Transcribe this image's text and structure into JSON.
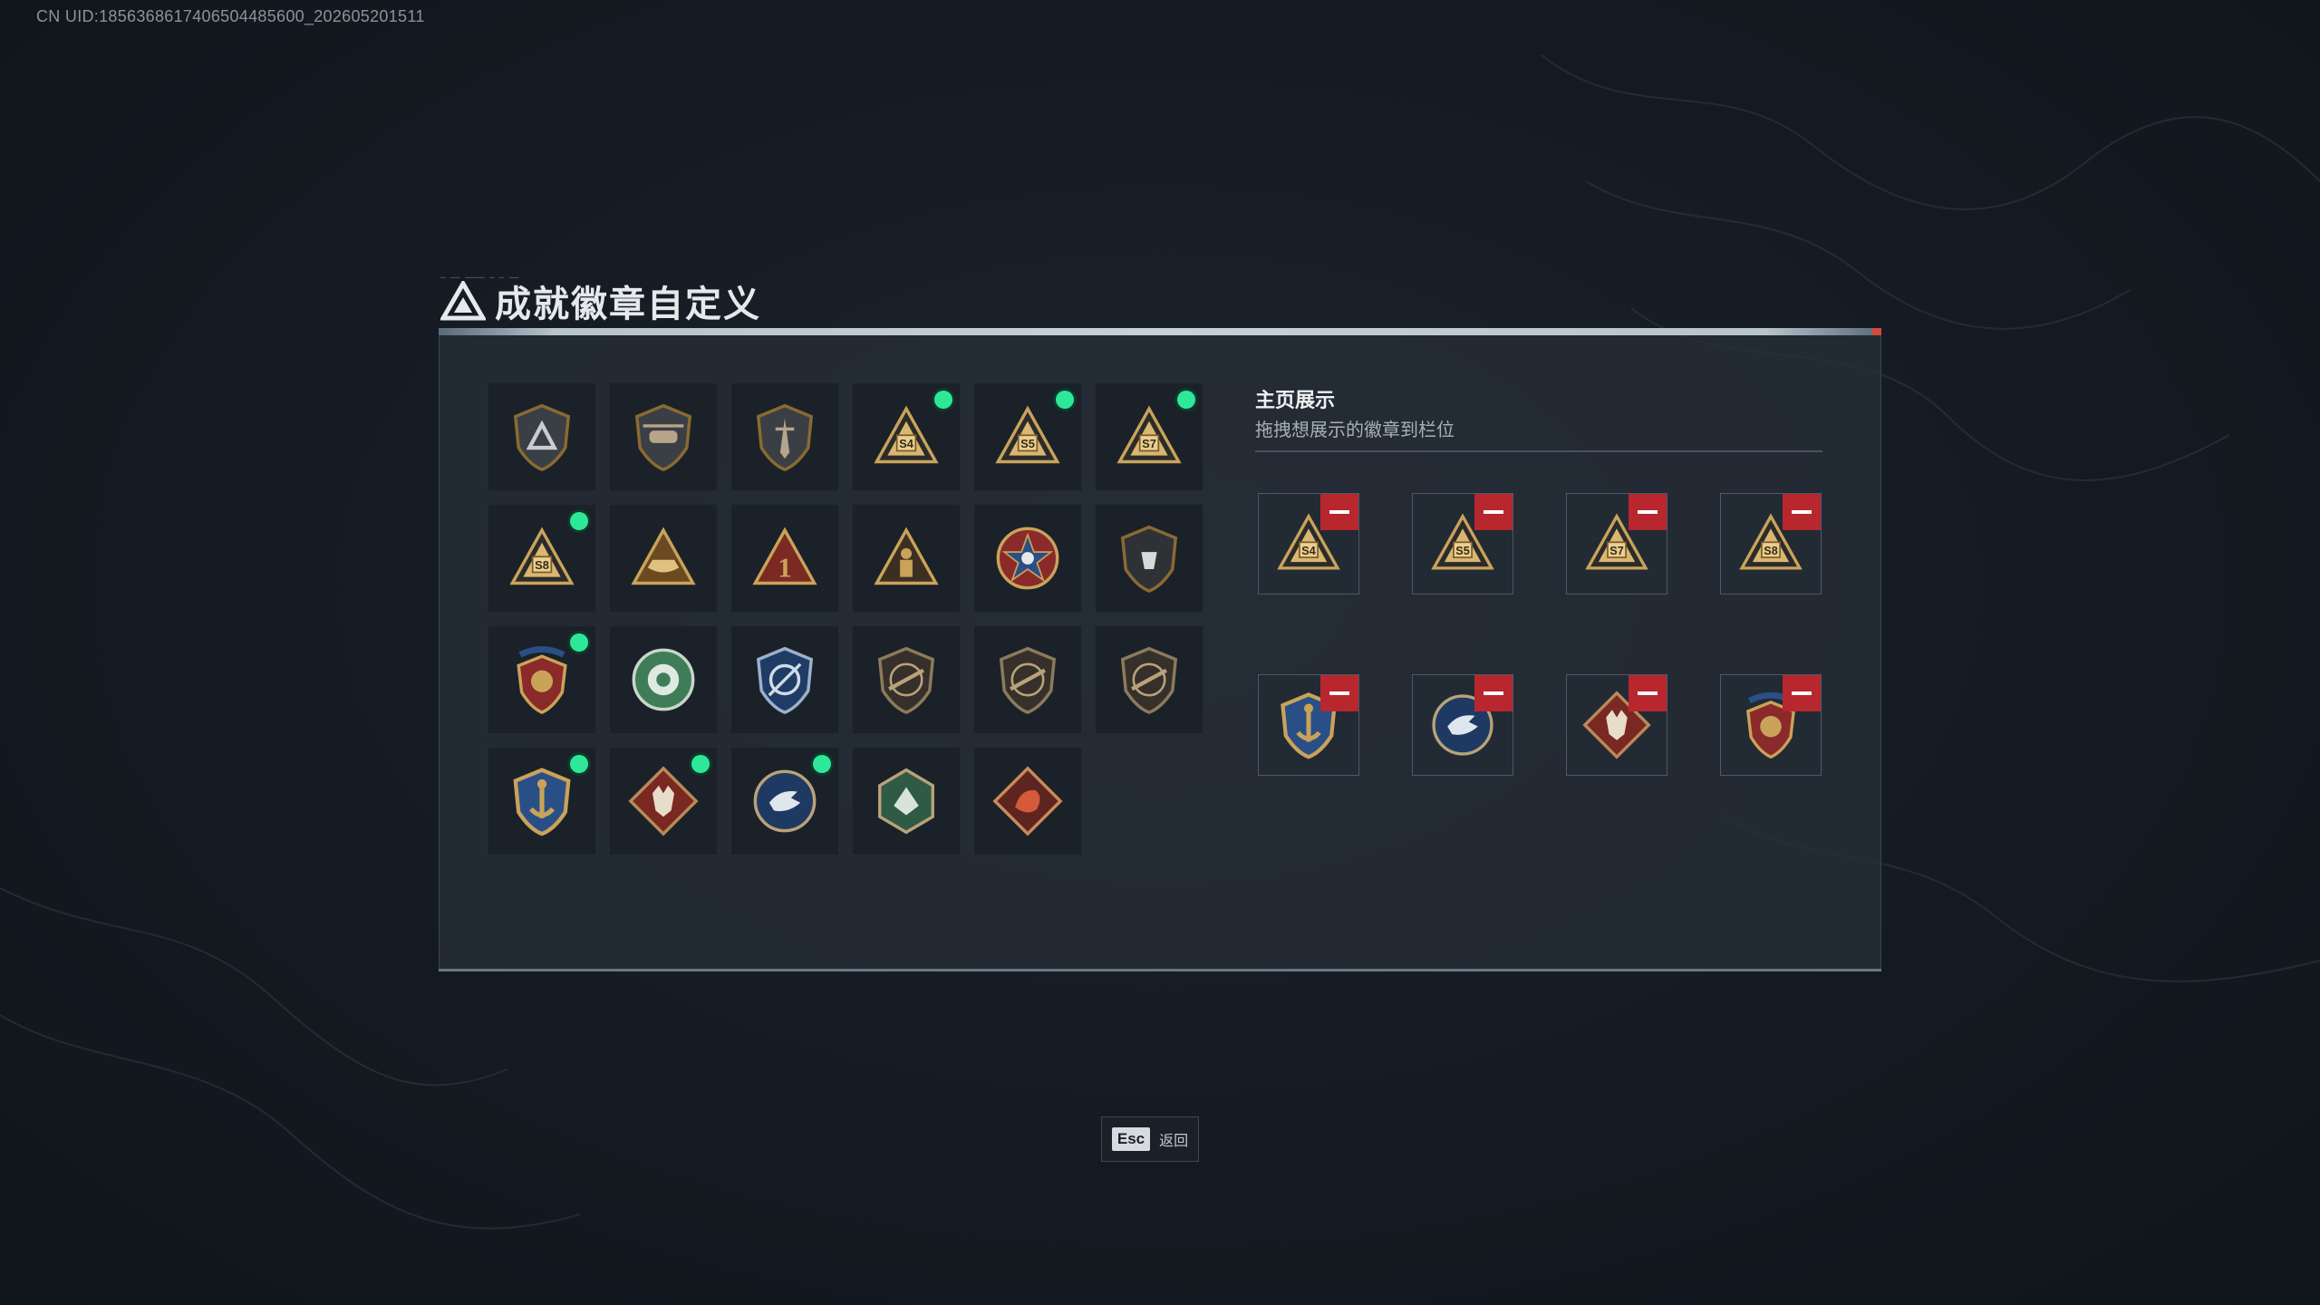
{
  "watermark": {
    "uid": "CN UID:1856368617406504485600_202605201511"
  },
  "header": {
    "title": "成就徽章自定义",
    "deco": "─ ── ──── ─ ─ ──"
  },
  "colors": {
    "accent_green": "#2ee89a",
    "remove_red": "#b8262e",
    "gold": "#c9a35a",
    "panel": "#262e37"
  },
  "badge_grid": {
    "items": [
      {
        "icon": "triangle-shield-badge-icon",
        "new": false
      },
      {
        "icon": "helicopter-shield-badge-icon",
        "new": false
      },
      {
        "icon": "dagger-shield-badge-icon",
        "new": false
      },
      {
        "icon": "season-s4-badge-icon",
        "new": true,
        "label": "S4"
      },
      {
        "icon": "season-s5-badge-icon",
        "new": true,
        "label": "S5"
      },
      {
        "icon": "season-s7-badge-icon",
        "new": true,
        "label": "S7"
      },
      {
        "icon": "season-s8-badge-icon",
        "new": true,
        "label": "S8"
      },
      {
        "icon": "boat-triangle-badge-icon",
        "new": false
      },
      {
        "icon": "rank-one-triangle-badge-icon",
        "new": false,
        "label": "1"
      },
      {
        "icon": "soldier-triangle-badge-icon",
        "new": false
      },
      {
        "icon": "skull-star-badge-icon",
        "new": false
      },
      {
        "icon": "hand-shield-badge-icon",
        "new": false
      },
      {
        "icon": "starred-crest-badge-icon",
        "new": true
      },
      {
        "icon": "green-emblem-badge-icon",
        "new": false
      },
      {
        "icon": "blue-crosshair-badge-icon",
        "new": false
      },
      {
        "icon": "rifle-shield-badge-icon",
        "new": false
      },
      {
        "icon": "rifle-shield-badge-icon",
        "new": false
      },
      {
        "icon": "rifle-shield-badge-icon",
        "new": false
      },
      {
        "icon": "gold-anchor-crest-badge-icon",
        "new": true
      },
      {
        "icon": "wolf-diamond-badge-icon",
        "new": true
      },
      {
        "icon": "eagle-round-badge-icon",
        "new": true
      },
      {
        "icon": "green-beast-badge-icon",
        "new": false
      },
      {
        "icon": "dragon-diamond-badge-icon",
        "new": false
      }
    ]
  },
  "showcase": {
    "title": "主页展示",
    "subtitle": "拖拽想展示的徽章到栏位",
    "slots": [
      {
        "icon": "season-s4-badge-icon",
        "label": "S4"
      },
      {
        "icon": "season-s5-badge-icon",
        "label": "S5"
      },
      {
        "icon": "season-s7-badge-icon",
        "label": "S7"
      },
      {
        "icon": "season-s8-badge-icon",
        "label": "S8"
      },
      {
        "icon": "gold-anchor-crest-badge-icon"
      },
      {
        "icon": "eagle-round-badge-icon"
      },
      {
        "icon": "wolf-diamond-badge-icon"
      },
      {
        "icon": "starred-crest-badge-icon"
      }
    ]
  },
  "footer": {
    "esc_key": "Esc",
    "back_label": "返回"
  }
}
